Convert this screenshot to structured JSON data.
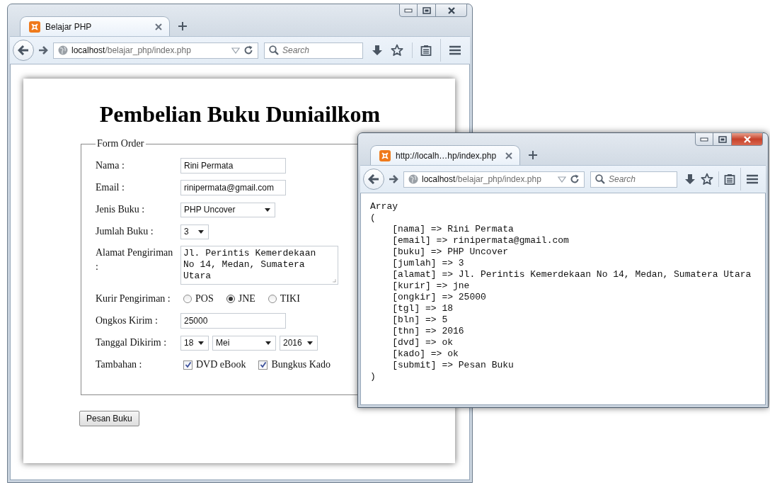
{
  "windows": [
    {
      "kind": "form",
      "active": false,
      "tab_title": "Belajar PHP",
      "url_host": "localhost",
      "url_path": "/belajar_php/index.php",
      "search_placeholder": "Search",
      "page": {
        "heading": "Pembelian Buku Duniailkom",
        "legend": "Form Order",
        "fields": [
          {
            "kind": "text",
            "label": "Nama :",
            "value": "Rini Permata"
          },
          {
            "kind": "text",
            "label": "Email :",
            "value": "rinipermata@gmail.com"
          },
          {
            "kind": "select",
            "label": "Jenis Buku :",
            "values": [
              "PHP Uncover"
            ]
          },
          {
            "kind": "select",
            "label": "Jumlah Buku :",
            "values": [
              "3"
            ]
          },
          {
            "kind": "textarea",
            "label": "Alamat Pengiriman :",
            "value": "Jl. Perintis Kemerdekaan No 14, Medan, Sumatera Utara"
          },
          {
            "kind": "radio",
            "label": "Kurir Pengiriman :",
            "options": [
              {
                "label": "POS",
                "selected": false
              },
              {
                "label": "JNE",
                "selected": true
              },
              {
                "label": "TIKI",
                "selected": false
              }
            ]
          },
          {
            "kind": "text",
            "label": "Ongkos Kirim :",
            "value": "25000"
          },
          {
            "kind": "select",
            "label": "Tanggal Dikirim :",
            "values": [
              "18",
              "Mei",
              "2016"
            ]
          },
          {
            "kind": "checkbox",
            "label": "Tambahan :",
            "options": [
              {
                "label": "DVD eBook",
                "checked": true
              },
              {
                "label": "Bungkus Kado",
                "checked": true
              }
            ]
          }
        ],
        "submit": "Pesan Buku"
      }
    },
    {
      "kind": "result",
      "active": true,
      "tab_title": "http://localh…hp/index.php",
      "url_host": "localhost",
      "url_path": "/belajar_php/index.php",
      "search_placeholder": "Search",
      "output": [
        "Array",
        "(",
        "    [nama] => Rini Permata",
        "    [email] => rinipermata@gmail.com",
        "    [buku] => PHP Uncover",
        "    [jumlah] => 3",
        "    [alamat] => Jl. Perintis Kemerdekaan No 14, Medan, Sumatera Utara",
        "    [kurir] => jne",
        "    [ongkir] => 25000",
        "    [tgl] => 18",
        "    [bln] => 5",
        "    [thn] => 2016",
        "    [dvd] => ok",
        "    [kado] => ok",
        "    [submit] => Pesan Buku",
        ")"
      ]
    }
  ]
}
